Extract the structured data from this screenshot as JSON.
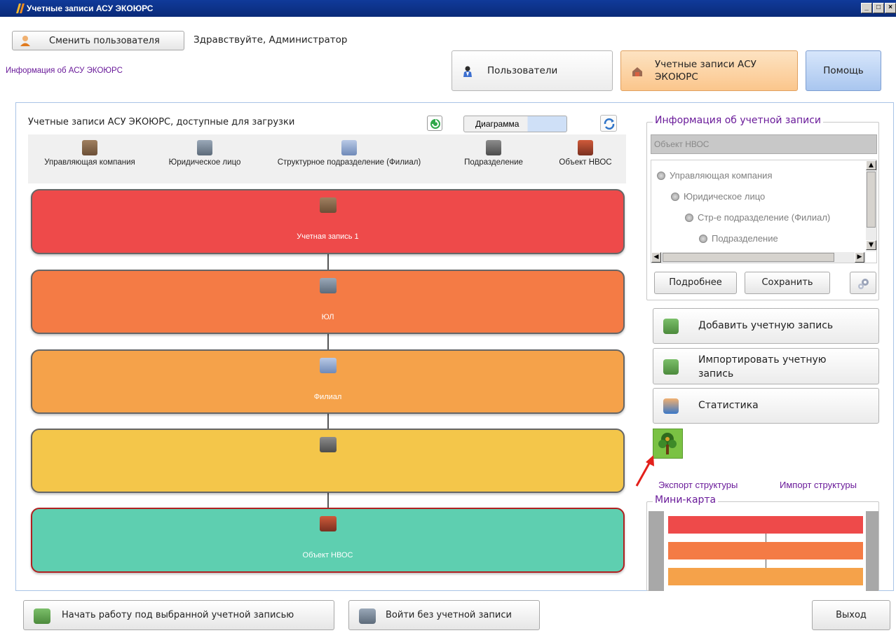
{
  "window": {
    "title": "Учетные записи АСУ ЭКОЮРС"
  },
  "header": {
    "switch_user_label": "Сменить пользователя",
    "greeting": "Здравствуйте, Администратор",
    "info_link": "Информация об АСУ ЭКОЮРС"
  },
  "nav": {
    "users_label": "Пользователи",
    "accounts_label_line1": "Учетные записи АСУ",
    "accounts_label_line2": "ЭКОЮРС",
    "help_label": "Помощь"
  },
  "diagram": {
    "title": "Учетные записи АСУ ЭКОЮРС, доступные для загрузки",
    "view_toggle_label": "Диаграмма",
    "categories": [
      {
        "label": "Управляющая компания",
        "icon": "management-company-icon"
      },
      {
        "label": "Юридическое лицо",
        "icon": "legal-entity-icon"
      },
      {
        "label": "Структурное подразделение (Филиал)",
        "icon": "branch-icon"
      },
      {
        "label": "Подразделение",
        "icon": "department-icon"
      },
      {
        "label": "Объект НВОС",
        "icon": "nvos-object-icon"
      }
    ],
    "nodes": [
      {
        "label": "Учетная запись 1",
        "color": "#ee4a4a",
        "icon": "management-company-icon"
      },
      {
        "label": "ЮЛ",
        "color": "#f47b45",
        "icon": "legal-entity-icon"
      },
      {
        "label": "Филиал",
        "color": "#f5a24a",
        "icon": "branch-icon"
      },
      {
        "label": "",
        "color": "#f4c64a",
        "icon": "department-icon"
      },
      {
        "label": "Объект НВОС",
        "color": "#5ecfb0",
        "icon": "nvos-object-icon"
      }
    ]
  },
  "account_info": {
    "legend": "Информация об учетной записи",
    "name_value": "Объект НВОС",
    "tree": [
      "Управляющая компания",
      "Юридическое лицо",
      "Стр-е подразделение (Филиал)",
      "Подразделение"
    ],
    "details_label": "Подробнее",
    "save_label": "Сохранить"
  },
  "actions": {
    "add_label": "Добавить учетную запись",
    "import_line1": "Импортировать учетную",
    "import_line2": "запись",
    "stats_label": "Статистика"
  },
  "structure": {
    "export_label": "Экспорт структуры",
    "import_label": "Импорт структуры"
  },
  "minimap": {
    "legend": "Мини-карта",
    "bar_colors": [
      "#ee4a4a",
      "#f47b45",
      "#f5a24a"
    ]
  },
  "footer": {
    "start_label": "Начать работу под выбранной учетной записью",
    "login_without_label": "Войти без учетной записи",
    "exit_label": "Выход"
  }
}
